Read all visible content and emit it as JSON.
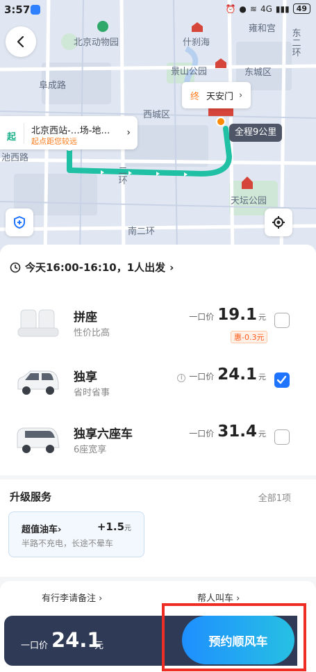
{
  "status": {
    "time": "3:57",
    "battery": "49",
    "network": "4G"
  },
  "map": {
    "labels": [
      "北京动物园",
      "什刹海",
      "雍和宫",
      "东城区",
      "阜成路",
      "景山公园",
      "西城区",
      "天坛公园",
      "南二环",
      "二环",
      "东二环",
      "池西路"
    ],
    "end_tag": "终",
    "end_name": "天安门",
    "start_tag": "起",
    "start_name": "北京西站-…场-地…",
    "start_hint": "起点距您较远",
    "distance": "全程9公里"
  },
  "trip": {
    "time_text": "今天16:00-16:10，1人出发"
  },
  "options": [
    {
      "title": "拼座",
      "subtitle": "性价比高",
      "price_label": "一口价",
      "price": "19.1",
      "unit": "元",
      "discount": "惠-0.3元",
      "checked": false,
      "icon": "seat-icon"
    },
    {
      "title": "独享",
      "subtitle": "省时省事",
      "price_label": "一口价",
      "price": "24.1",
      "unit": "元",
      "checked": true,
      "icon": "car-icon"
    },
    {
      "title": "独享六座车",
      "subtitle": "6座宽享",
      "price_label": "一口价",
      "price": "31.4",
      "unit": "元",
      "checked": false,
      "icon": "van-icon"
    }
  ],
  "upgrade": {
    "title": "升级服务",
    "all": "全部1项",
    "service": {
      "name": "超值油车",
      "value": "+1.5",
      "unit": "元",
      "desc": "半路不充电，长途不晕车"
    }
  },
  "extras": {
    "luggage": "有行李请备注",
    "call_for_others": "帮人叫车"
  },
  "bottom": {
    "price_label": "一口价",
    "price": "24.1",
    "unit": "元",
    "cta": "预约顺风车"
  }
}
